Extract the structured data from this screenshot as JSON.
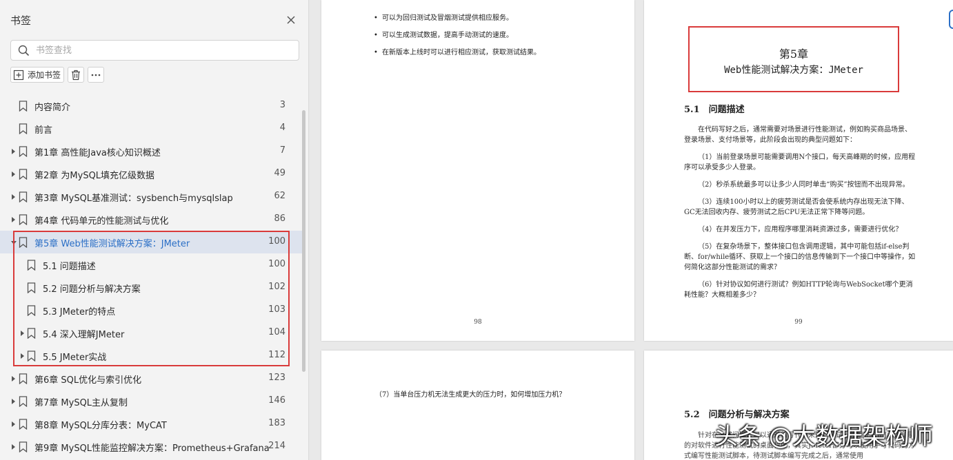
{
  "sidebar": {
    "title": "书签",
    "search_placeholder": "书签查找",
    "add_bookmark_label": "添加书签",
    "items": [
      {
        "label": "内容简介",
        "page": "3",
        "level": 1,
        "expandable": false
      },
      {
        "label": "前言",
        "page": "4",
        "level": 1,
        "expandable": false
      },
      {
        "label": "第1章 高性能Java核心知识概述",
        "page": "7",
        "level": 1,
        "expandable": true
      },
      {
        "label": "第2章 为MySQL填充亿级数据",
        "page": "49",
        "level": 1,
        "expandable": true
      },
      {
        "label": "第3章 MySQL基准测试：sysbench与mysqlslap",
        "page": "62",
        "level": 1,
        "expandable": true
      },
      {
        "label": "第4章 代码单元的性能测试与优化",
        "page": "86",
        "level": 1,
        "expandable": true
      },
      {
        "label": "第5章 Web性能测试解决方案：JMeter",
        "page": "100",
        "level": 1,
        "expandable": true,
        "active": true
      },
      {
        "label": "5.1 问题描述",
        "page": "100",
        "level": 2,
        "expandable": false
      },
      {
        "label": "5.2 问题分析与解决方案",
        "page": "102",
        "level": 2,
        "expandable": false
      },
      {
        "label": "5.3 JMeter的特点",
        "page": "103",
        "level": 2,
        "expandable": false
      },
      {
        "label": "5.4 深入理解JMeter",
        "page": "104",
        "level": 2,
        "expandable": true
      },
      {
        "label": "5.5 JMeter实战",
        "page": "112",
        "level": 2,
        "expandable": true
      },
      {
        "label": "第6章 SQL优化与索引优化",
        "page": "123",
        "level": 1,
        "expandable": true
      },
      {
        "label": "第7章 MySQL主从复制",
        "page": "146",
        "level": 1,
        "expandable": true
      },
      {
        "label": "第8章 MySQL分库分表：MyCAT",
        "page": "183",
        "level": 1,
        "expandable": true
      },
      {
        "label": "第9章 MySQL性能监控解决方案：Prometheus+Grafana",
        "page": "214",
        "level": 1,
        "expandable": true
      }
    ]
  },
  "doc": {
    "page98": {
      "bullets": [
        "可以为回归测试及冒烟测试提供相应服务。",
        "可以生成测试数据，提高手动测试的速度。",
        "在新版本上线时可以进行相应测试，获取测试结果。"
      ],
      "page_number": "98"
    },
    "page99": {
      "chapter_number": "第5章",
      "chapter_title": "Web性能测试解决方案：JMeter",
      "section_heading": "5.1　问题描述",
      "paragraphs": [
        "在代码写好之后，通常需要对场景进行性能测试，例如购买商品场景、登录场景、支付场景等，此阶段会出现的典型问题如下：",
        "（1）当前登录场景可能需要调用N个接口，每天高峰期的时候，应用程序可以承受多少人登录。",
        "（2）秒杀系统最多可以让多少人同时单击“购买”按钮而不出现异常。",
        "（3）连续100小时以上的疲劳测试是否会使系统内存出现无法下降、GC无法回收内存、疲劳测试之后CPU无法正常下降等问题。",
        "（4）在并发压力下，应用程序哪里消耗资源过多，需要进行优化？",
        "（5）在复杂场景下，整体接口包含调用逻辑，其中可能包括if-else判断、for/while循环、获取上一个接口的信息传输到下一个接口中等操作，如何简化这部分性能测试的需求？",
        "（6）针对协议如何进行测试？例如HTTP轮询与WebSocket哪个更消耗性能？大概相差多少？"
      ],
      "page_number": "99"
    },
    "page100": {
      "question": "（7）当单台压力机无法生成更大的压力时，如何增加压力机？"
    },
    "page101": {
      "section_heading": "5.2　问题分析与解决方案",
      "fragment": "针对在上述问题，可以通过编写代码来进行测试，但是完全由Java编写的对软件进行性能测试的桌面程序，其实JMeter部分可以使用手写代码的方式编写性能测试脚本，待测试脚本编写完成之后，通常使用"
    }
  },
  "watermark": "头条 @大数据架构师"
}
